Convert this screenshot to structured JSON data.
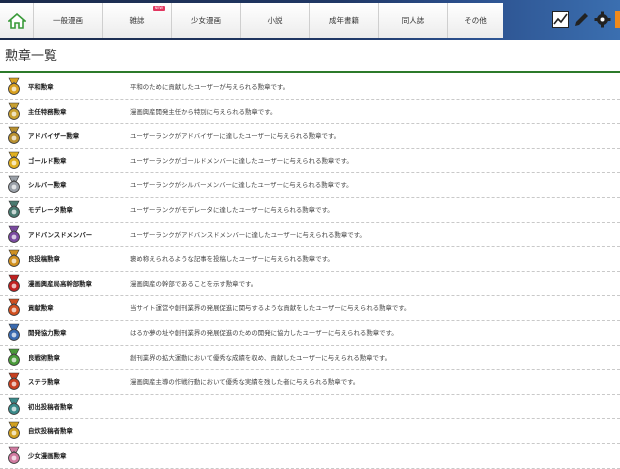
{
  "nav": {
    "home_icon": "home-icon",
    "tabs": [
      {
        "label": "一般漫画"
      },
      {
        "label": "雑誌",
        "badge": "NEW"
      },
      {
        "label": "少女漫画"
      },
      {
        "label": "小説"
      },
      {
        "label": "成年書籍"
      },
      {
        "label": "同人誌"
      },
      {
        "label": "その他"
      }
    ],
    "tools": [
      "chart-icon",
      "pencil-icon",
      "gear-icon",
      "rss-icon"
    ]
  },
  "page_title": "勲章一覧",
  "medals": [
    {
      "name": "平和勲章",
      "desc": "平和のために貢献したユーザーが与えられる勲章です。",
      "icon": "medal-peace-icon",
      "color": "#d8a020"
    },
    {
      "name": "主任特務勲章",
      "desc": "漫画興産開発主任から特別に与えられる勲章です。",
      "icon": "medal-chief-icon",
      "color": "#c8a030"
    },
    {
      "name": "アドバイザー勲章",
      "desc": "ユーザーランクがアドバイザーに達したユーザーに与えられる勲章です。",
      "icon": "medal-advisor-icon",
      "color": "#b89030"
    },
    {
      "name": "ゴールド勲章",
      "desc": "ユーザーランクがゴールドメンバーに達したユーザーに与えられる勲章です。",
      "icon": "medal-gold-icon",
      "color": "#e0b020"
    },
    {
      "name": "シルバー勲章",
      "desc": "ユーザーランクがシルバーメンバーに達したユーザーに与えられる勲章です。",
      "icon": "medal-silver-icon",
      "color": "#9aa0a8"
    },
    {
      "name": "モデレータ勲章",
      "desc": "ユーザーランクがモデレータに達したユーザーに与えられる勲章です。",
      "icon": "medal-moderator-icon",
      "color": "#4a7a70"
    },
    {
      "name": "アドバンスドメンバー",
      "desc": "ユーザーランクがアドバンスドメンバーに達したユーザーに与えられる勲章です。",
      "icon": "medal-advanced-icon",
      "color": "#7a4aa0"
    },
    {
      "name": "良投稿勲章",
      "desc": "褒め称えられるような記事を投稿したユーザーに与えられる勲章です。",
      "icon": "medal-good-post-icon",
      "color": "#d09020"
    },
    {
      "name": "漫画興産局高幹部勲章",
      "desc": "漫画興産の幹部であることを示す勲章です。",
      "icon": "medal-executive-icon",
      "color": "#c02020"
    },
    {
      "name": "貢献勲章",
      "desc": "当サイト運営や創刊業界の発展促進に関与するような貢献をしたユーザーに与えられる勲章です。",
      "icon": "medal-contribution-icon",
      "color": "#d05020"
    },
    {
      "name": "開発協力勲章",
      "desc": "はるか夢の址や創刊業界の発展促進のための開発に協力したユーザーに与えられる勲章です。",
      "icon": "medal-dev-icon",
      "color": "#3a6ab0"
    },
    {
      "name": "良戦術勲章",
      "desc": "創刊業界の拡大運動において優秀な成績を収め、貢献したユーザーに与えられる勲章です。",
      "icon": "medal-tactics-icon",
      "color": "#4a9a3a"
    },
    {
      "name": "ステラ勲章",
      "desc": "漫画興産主導の作戦行動において優秀な実績を残した者に与えられる勲章です。",
      "icon": "medal-stella-icon",
      "color": "#c84020"
    },
    {
      "name": "初出投稿者勲章",
      "desc": "",
      "icon": "medal-first-post-icon",
      "color": "#3a8a8a"
    },
    {
      "name": "自炊投稿者勲章",
      "desc": "",
      "icon": "medal-scan-icon",
      "color": "#d0a020"
    },
    {
      "name": "少女漫画勲章",
      "desc": "",
      "icon": "medal-shoujo-icon",
      "color": "#d07aa0"
    }
  ]
}
